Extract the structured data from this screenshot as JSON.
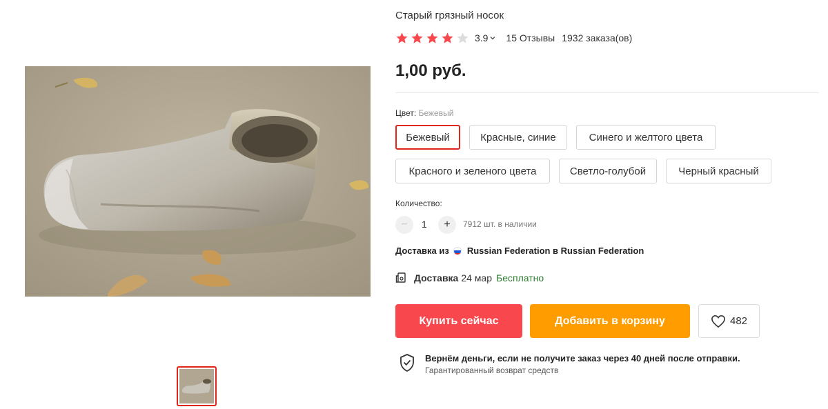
{
  "product": {
    "title": "Старый грязный носок",
    "rating": "3.9",
    "rating_stars": 3.9,
    "reviews": "15 Отзывы",
    "orders": "1932 заказа(ов)",
    "price": "1,00 руб."
  },
  "color": {
    "label": "Цвет:",
    "selected": "Бежевый",
    "options": [
      "Бежевый",
      "Красные, синие",
      "Синего и желтого цвета",
      "Красного и зеленого цвета",
      "Светло-голубой",
      "Черный красный"
    ]
  },
  "quantity": {
    "label": "Количество:",
    "minus": "−",
    "plus": "+",
    "value": "1",
    "stock": "7912 шт. в наличии"
  },
  "shipping": {
    "prefix": "Доставка из",
    "route": "Russian Federation в Russian Federation"
  },
  "delivery": {
    "label": "Доставка",
    "date": "24 мар",
    "price": "Бесплатно"
  },
  "actions": {
    "buy_now": "Купить сейчас",
    "add_to_cart": "Добавить в корзину",
    "wishlist_count": "482"
  },
  "guarantee": {
    "title": "Вернём деньги, если не получите заказ через 40 дней после отправки.",
    "subtitle": "Гарантированный возврат средств"
  },
  "icons": {
    "star": "star-icon",
    "chevron": "chevron-down-icon",
    "flag": "russia-flag-icon",
    "truck": "delivery-icon",
    "heart": "heart-icon",
    "shield": "shield-check-icon"
  },
  "colors": {
    "accent_red": "#e1251b",
    "buy_button": "#f8484d",
    "cart_button": "#ff9c00",
    "star": "#f8484d",
    "free_green": "#2e7d32"
  }
}
